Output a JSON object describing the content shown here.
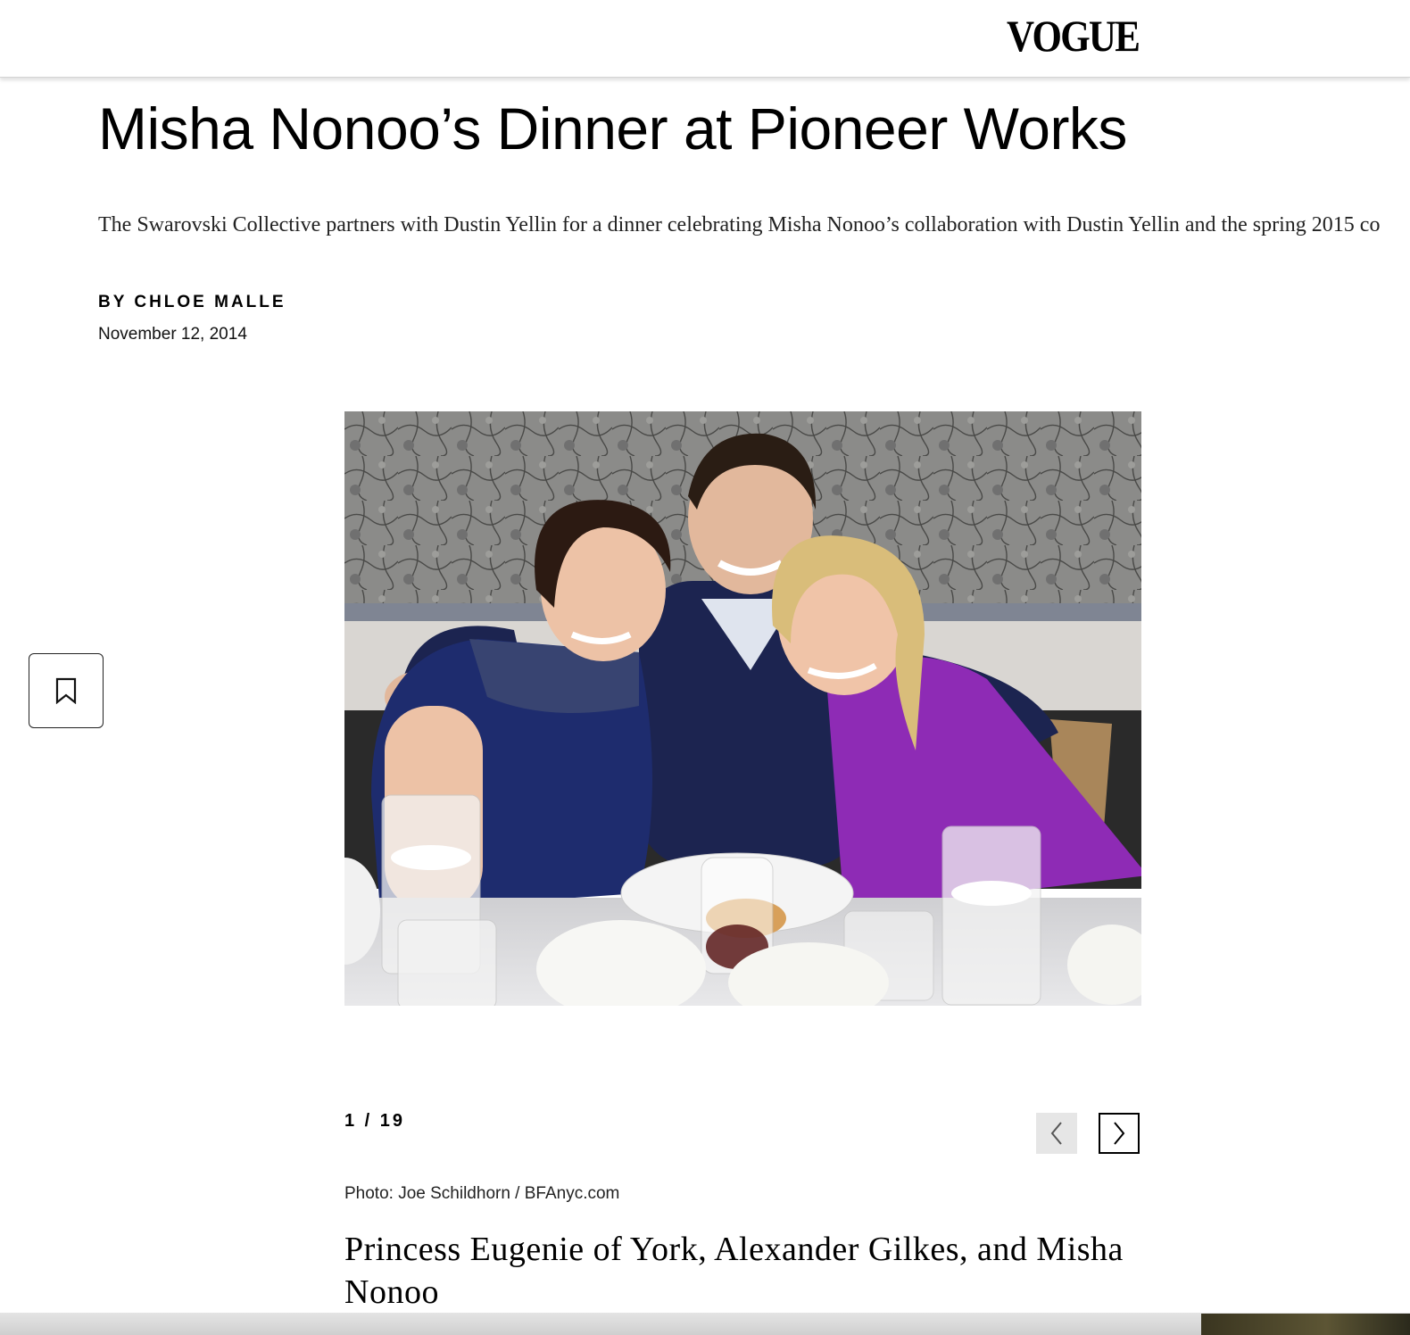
{
  "header": {
    "logo": "VOGUE"
  },
  "article": {
    "title": "Misha Nonoo’s Dinner at Pioneer Works",
    "dek": "The Swarovski Collective partners with Dustin Yellin for a dinner celebrating Misha Nonoo’s collaboration with Dustin Yellin and the spring 2015 co",
    "byline_prefix": "BY",
    "author": "CHLOE MALLE",
    "date": "November 12, 2014"
  },
  "gallery": {
    "counter": "1 / 19",
    "credit": "Photo: Joe Schildhorn / BFAnyc.com",
    "caption": "Princess Eugenie of York, Alexander Gilkes, and Misha Nonoo",
    "prev_icon": "chevron-left-icon",
    "next_icon": "chevron-right-icon"
  },
  "bookmark": {
    "icon": "bookmark-icon"
  },
  "colors": {
    "navy": "#1d2a5c",
    "purple": "#8e2bb5",
    "wall": "#8a8a88",
    "prev_bg": "#e6e6e6"
  }
}
